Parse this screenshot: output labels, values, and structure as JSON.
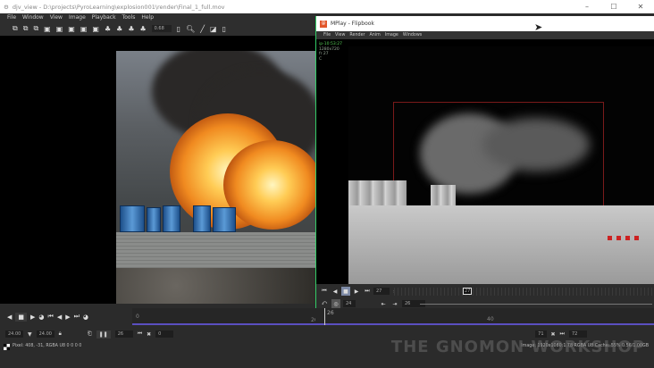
{
  "djv": {
    "title": "djv_view - D:\\projects\\PyroLearning\\explosion001\\render\\Final_1_full.mov",
    "menu": [
      "File",
      "Window",
      "View",
      "Image",
      "Playback",
      "Tools",
      "Help"
    ],
    "zoom": "0.68",
    "speed": "24.00",
    "actual_speed": "24.00",
    "current_frame": "26",
    "in_point": "0",
    "out_point": "71",
    "end_frame": "72",
    "timeline": {
      "start": "0",
      "tick": "26"
    },
    "pixel_info": "Pixel: 408, -31, RGBA U8 0 0 0 0",
    "image_info": "Image: 1920x1080:1.78 RGBA U8  Cache: 55% 0.56/1.00GB"
  },
  "mplay": {
    "title": "MPlay - Flipbook",
    "menu": [
      "File",
      "View",
      "Render",
      "Anim",
      "Image",
      "Windows"
    ],
    "info": [
      "ip-10:53:27",
      "1280x720",
      "fr 27",
      "C"
    ],
    "frame": "27",
    "fps": "24",
    "range_start": "26",
    "marker": "27",
    "timeline": {
      "a": "26",
      "b": "40"
    }
  },
  "watermark": "THE GNOMON WORKSHOP",
  "colors": {
    "accent": "#5a4fc0",
    "mplay_border": "#33cc66"
  }
}
